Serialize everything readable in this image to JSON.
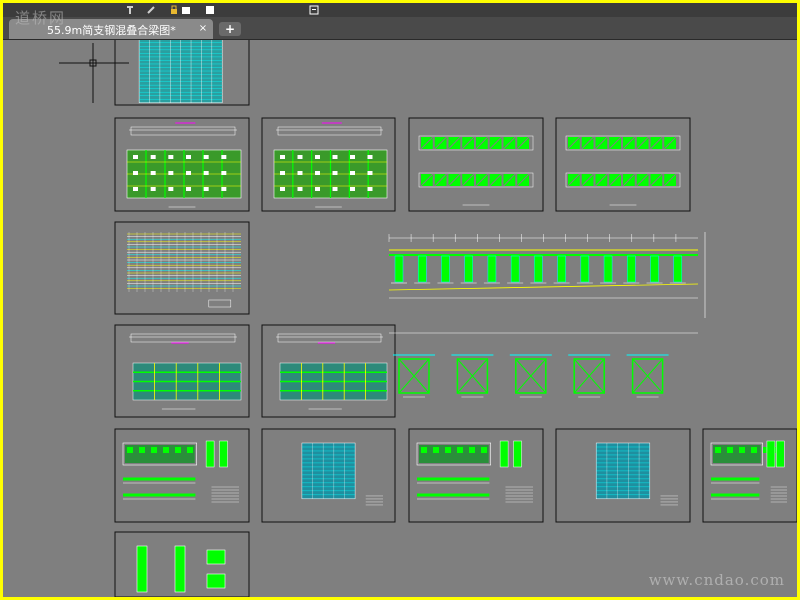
{
  "app": {
    "tab": {
      "title": "55.9m简支钢混叠合梁图*",
      "close_glyph": "×",
      "new_tab_glyph": "+"
    },
    "watermarks": {
      "top": "道桥网",
      "bottom": "www.cndao.com"
    }
  },
  "colors": {
    "frame": "#ffff00",
    "canvas": "#7f7f7f",
    "tabbar": "#4a4a4a",
    "active_tab": "#8a8a8a",
    "cad_green": "#00ff00",
    "cad_cyan": "#00ffff",
    "cad_magenta": "#ff00ff",
    "cad_yellow": "#ffff00",
    "cad_white": "#ffffff"
  },
  "icons": [
    "menu-icon",
    "pin-icon",
    "brush-icon",
    "lock-icon",
    "layer-icon",
    "page-icon"
  ],
  "sheets": [
    {
      "name": "sheet-quantity-table",
      "kind": "table"
    },
    {
      "name": "sheet-plan-1",
      "kind": "plan"
    },
    {
      "name": "sheet-plan-2",
      "kind": "plan"
    },
    {
      "name": "sheet-truss-1",
      "kind": "truss"
    },
    {
      "name": "sheet-truss-2",
      "kind": "truss"
    },
    {
      "name": "sheet-rebar-layout",
      "kind": "rebar"
    },
    {
      "name": "sheet-elevation-large",
      "kind": "elevation"
    },
    {
      "name": "sheet-deck-plan-1",
      "kind": "deck"
    },
    {
      "name": "sheet-deck-plan-2",
      "kind": "deck"
    },
    {
      "name": "sheet-cross-frames",
      "kind": "crossframe"
    },
    {
      "name": "sheet-detail-1",
      "kind": "detail"
    },
    {
      "name": "sheet-table-2",
      "kind": "smalltable"
    },
    {
      "name": "sheet-detail-2",
      "kind": "detail"
    },
    {
      "name": "sheet-table-3",
      "kind": "smalltable"
    },
    {
      "name": "sheet-detail-3",
      "kind": "detail"
    },
    {
      "name": "sheet-section",
      "kind": "section"
    }
  ]
}
